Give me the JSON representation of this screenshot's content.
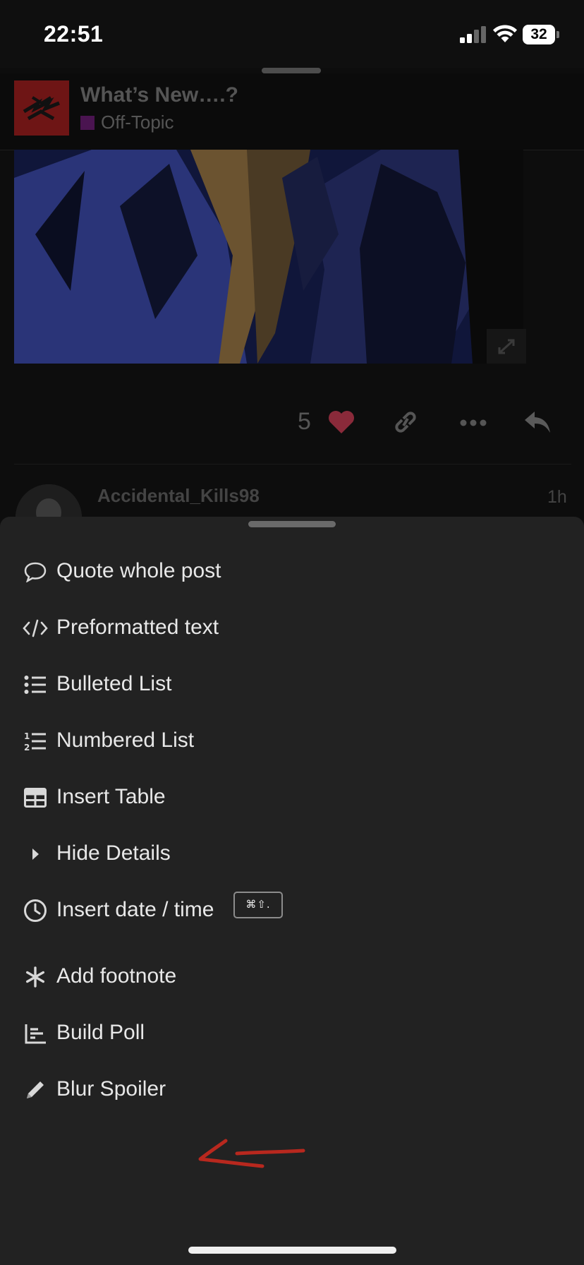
{
  "status_bar": {
    "time": "22:51",
    "battery": "32"
  },
  "topic": {
    "title": "What’s New….?",
    "category": "Off-Topic",
    "category_color": "#4a1450"
  },
  "post": {
    "like_count": "5",
    "heart_color": "#8a2a3a"
  },
  "next_post": {
    "username": "Accidental_Kills98",
    "time": "1h"
  },
  "menu": {
    "items": [
      {
        "label": "Quote whole post",
        "icon": "speech-bubble-icon"
      },
      {
        "label": "Preformatted text",
        "icon": "code-icon"
      },
      {
        "label": "Bulleted List",
        "icon": "bulleted-list-icon"
      },
      {
        "label": "Numbered List",
        "icon": "numbered-list-icon"
      },
      {
        "label": "Insert Table",
        "icon": "table-icon"
      },
      {
        "label": "Hide Details",
        "icon": "caret-right-icon"
      },
      {
        "label": "Insert date / time",
        "icon": "clock-icon",
        "shortcut": "⌘⇧."
      },
      {
        "label": "Add footnote",
        "icon": "asterisk-icon"
      },
      {
        "label": "Build Poll",
        "icon": "chart-icon"
      },
      {
        "label": "Blur Spoiler",
        "icon": "pencil-icon"
      }
    ]
  },
  "annotation": {
    "color": "#b8281e"
  }
}
